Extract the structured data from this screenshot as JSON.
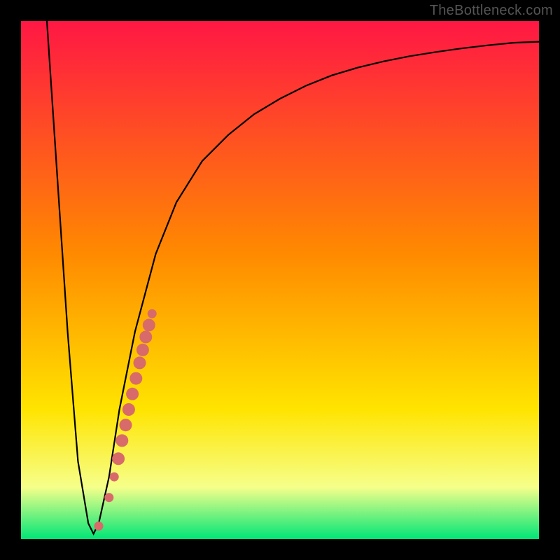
{
  "watermark": "TheBottleneck.com",
  "chart_data": {
    "type": "line",
    "title": "",
    "xlabel": "",
    "ylabel": "",
    "xlim": [
      0,
      100
    ],
    "ylim": [
      0,
      100
    ],
    "grid": false,
    "series": [
      {
        "name": "curve",
        "x": [
          5,
          7,
          9,
          11,
          13,
          14,
          15,
          17,
          19,
          22,
          26,
          30,
          35,
          40,
          45,
          50,
          55,
          60,
          65,
          70,
          75,
          80,
          85,
          90,
          95,
          100
        ],
        "y": [
          100,
          70,
          40,
          15,
          3,
          1,
          3,
          12,
          25,
          40,
          55,
          65,
          73,
          78,
          82,
          85,
          87.5,
          89.5,
          91,
          92.2,
          93.2,
          94,
          94.7,
          95.3,
          95.8,
          96
        ]
      }
    ],
    "points": [
      {
        "x": 15.0,
        "y": 2.5
      },
      {
        "x": 17.0,
        "y": 8.0
      },
      {
        "x": 18.0,
        "y": 12.0
      },
      {
        "x": 18.8,
        "y": 15.5
      },
      {
        "x": 19.5,
        "y": 19.0
      },
      {
        "x": 20.2,
        "y": 22.0
      },
      {
        "x": 20.8,
        "y": 25.0
      },
      {
        "x": 21.5,
        "y": 28.0
      },
      {
        "x": 22.2,
        "y": 31.0
      },
      {
        "x": 22.9,
        "y": 34.0
      },
      {
        "x": 23.5,
        "y": 36.5
      },
      {
        "x": 24.1,
        "y": 39.0
      },
      {
        "x": 24.7,
        "y": 41.3
      },
      {
        "x": 25.3,
        "y": 43.5
      }
    ],
    "colors": {
      "curve_stroke": "#000000",
      "point_fill": "#d86a6a",
      "gradient_top": "#ff1744",
      "gradient_mid1": "#ff8a00",
      "gradient_mid2": "#ffe400",
      "gradient_band": "#f6ff8a",
      "gradient_bottom": "#00e676",
      "frame": "#000000"
    }
  }
}
